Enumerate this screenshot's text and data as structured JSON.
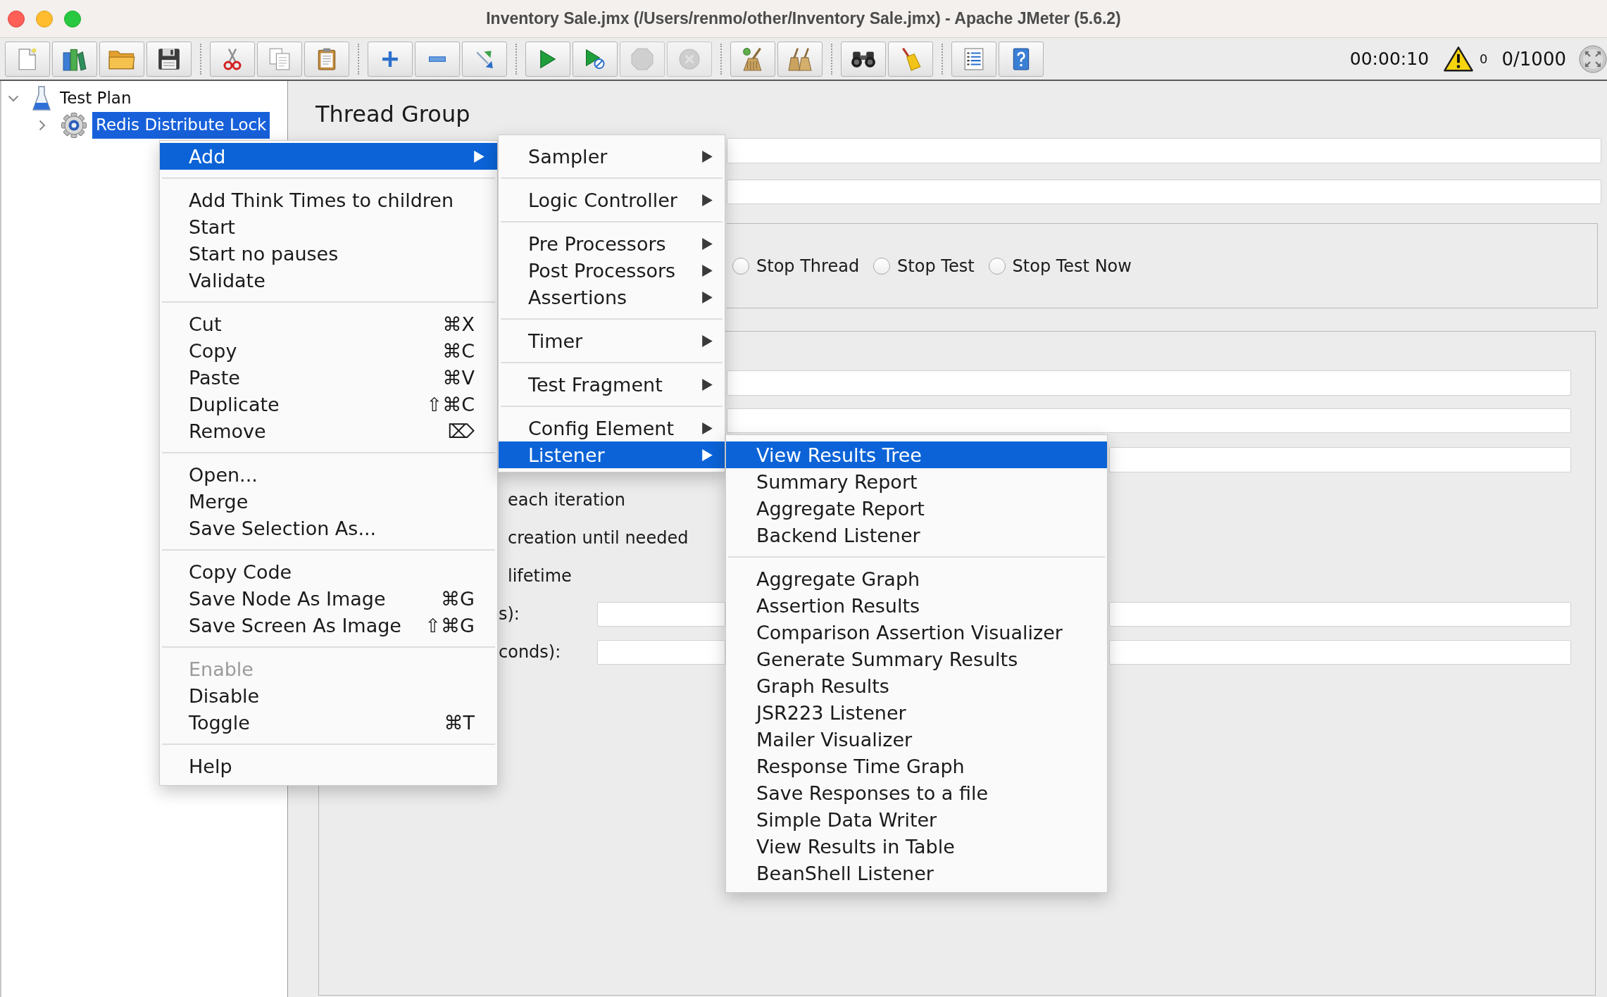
{
  "window": {
    "title": "Inventory Sale.jmx (/Users/renmo/other/Inventory Sale.jmx) - Apache JMeter (5.6.2)"
  },
  "toolbar": {
    "groups": [
      [
        {
          "kind": "new",
          "disabled": false
        },
        {
          "kind": "templates",
          "disabled": false
        },
        {
          "kind": "open",
          "disabled": false
        },
        {
          "kind": "save",
          "disabled": false
        }
      ],
      [
        {
          "kind": "cut",
          "disabled": false
        },
        {
          "kind": "copy",
          "disabled": false
        },
        {
          "kind": "paste",
          "disabled": false
        }
      ],
      [
        {
          "kind": "expand",
          "disabled": false
        },
        {
          "kind": "collapse",
          "disabled": false
        },
        {
          "kind": "toggle",
          "disabled": false
        }
      ],
      [
        {
          "kind": "start",
          "disabled": false
        },
        {
          "kind": "startnopause",
          "disabled": false
        },
        {
          "kind": "stop",
          "disabled": true
        },
        {
          "kind": "shutdown",
          "disabled": true
        }
      ],
      [
        {
          "kind": "clear",
          "disabled": false
        },
        {
          "kind": "clearall",
          "disabled": false
        }
      ],
      [
        {
          "kind": "search",
          "disabled": false
        },
        {
          "kind": "reset",
          "disabled": false
        }
      ],
      [
        {
          "kind": "functions",
          "disabled": false
        },
        {
          "kind": "help",
          "disabled": false
        }
      ]
    ]
  },
  "status": {
    "elapsed": "00:00:10",
    "errors": "0",
    "threads": "0/1000"
  },
  "tree": [
    {
      "label": "Test Plan",
      "kind": "plan",
      "expanded": true,
      "selected": false,
      "children": [
        {
          "label": "Redis Distribute Lock",
          "kind": "threadgroup",
          "expanded": false,
          "selected": true
        }
      ]
    }
  ],
  "panel": {
    "title": "Thread Group",
    "error_actions": [
      {
        "label": "Stop Thread",
        "selected": false
      },
      {
        "label": "Stop Test",
        "selected": false
      },
      {
        "label": "Stop Test Now",
        "selected": false
      }
    ],
    "rows": [
      {
        "kind": "text",
        "label": "each iteration"
      },
      {
        "kind": "text",
        "label": "creation until needed"
      },
      {
        "kind": "text",
        "label": "lifetime"
      },
      {
        "kind": "field",
        "label": "s):"
      },
      {
        "kind": "field",
        "label": "conds):"
      }
    ]
  },
  "context_menu": {
    "sections": [
      {
        "items": [
          {
            "label": "Add",
            "selected": true,
            "disabled": false,
            "submenu": true
          }
        ]
      },
      {
        "items": [
          {
            "label": "Add Think Times to children",
            "selected": false,
            "disabled": false,
            "submenu": false
          },
          {
            "label": "Start",
            "selected": false,
            "disabled": false,
            "submenu": false
          },
          {
            "label": "Start no pauses",
            "selected": false,
            "disabled": false,
            "submenu": false
          },
          {
            "label": "Validate",
            "selected": false,
            "disabled": false,
            "submenu": false
          }
        ]
      },
      {
        "items": [
          {
            "label": "Cut",
            "shortcut": "⌘X",
            "selected": false,
            "disabled": false,
            "submenu": false
          },
          {
            "label": "Copy",
            "shortcut": "⌘C",
            "selected": false,
            "disabled": false,
            "submenu": false
          },
          {
            "label": "Paste",
            "shortcut": "⌘V",
            "selected": false,
            "disabled": false,
            "submenu": false
          },
          {
            "label": "Duplicate",
            "shortcut": "⇧⌘C",
            "selected": false,
            "disabled": false,
            "submenu": false
          },
          {
            "label": "Remove",
            "shortcut": "⌦",
            "selected": false,
            "disabled": false,
            "submenu": false
          }
        ]
      },
      {
        "items": [
          {
            "label": "Open...",
            "selected": false,
            "disabled": false,
            "submenu": false
          },
          {
            "label": "Merge",
            "selected": false,
            "disabled": false,
            "submenu": false
          },
          {
            "label": "Save Selection As...",
            "selected": false,
            "disabled": false,
            "submenu": false
          }
        ]
      },
      {
        "items": [
          {
            "label": "Copy Code",
            "selected": false,
            "disabled": false,
            "submenu": false
          },
          {
            "label": "Save Node As Image",
            "shortcut": "⌘G",
            "selected": false,
            "disabled": false,
            "submenu": false
          },
          {
            "label": "Save Screen As Image",
            "shortcut": "⇧⌘G",
            "selected": false,
            "disabled": false,
            "submenu": false
          }
        ]
      },
      {
        "items": [
          {
            "label": "Enable",
            "selected": false,
            "disabled": true,
            "submenu": false
          },
          {
            "label": "Disable",
            "selected": false,
            "disabled": false,
            "submenu": false
          },
          {
            "label": "Toggle",
            "shortcut": "⌘T",
            "selected": false,
            "disabled": false,
            "submenu": false
          }
        ]
      },
      {
        "items": [
          {
            "label": "Help",
            "selected": false,
            "disabled": false,
            "submenu": false
          }
        ]
      }
    ]
  },
  "add_submenu": {
    "sections": [
      {
        "items": [
          {
            "label": "Sampler",
            "selected": false,
            "submenu": true
          }
        ]
      },
      {
        "items": [
          {
            "label": "Logic Controller",
            "selected": false,
            "submenu": true
          }
        ]
      },
      {
        "items": [
          {
            "label": "Pre Processors",
            "selected": false,
            "submenu": true
          },
          {
            "label": "Post Processors",
            "selected": false,
            "submenu": true
          },
          {
            "label": "Assertions",
            "selected": false,
            "submenu": true
          }
        ]
      },
      {
        "items": [
          {
            "label": "Timer",
            "selected": false,
            "submenu": true
          }
        ]
      },
      {
        "items": [
          {
            "label": "Test Fragment",
            "selected": false,
            "submenu": true
          }
        ]
      },
      {
        "items": [
          {
            "label": "Config Element",
            "selected": false,
            "submenu": true
          },
          {
            "label": "Listener",
            "selected": true,
            "submenu": true
          }
        ]
      }
    ]
  },
  "listener_submenu": {
    "sections": [
      {
        "items": [
          {
            "label": "View Results Tree",
            "selected": true
          },
          {
            "label": "Summary Report",
            "selected": false
          },
          {
            "label": "Aggregate Report",
            "selected": false
          },
          {
            "label": "Backend Listener",
            "selected": false
          }
        ]
      },
      {
        "items": [
          {
            "label": "Aggregate Graph",
            "selected": false
          },
          {
            "label": "Assertion Results",
            "selected": false
          },
          {
            "label": "Comparison Assertion Visualizer",
            "selected": false
          },
          {
            "label": "Generate Summary Results",
            "selected": false
          },
          {
            "label": "Graph Results",
            "selected": false
          },
          {
            "label": "JSR223 Listener",
            "selected": false
          },
          {
            "label": "Mailer Visualizer",
            "selected": false
          },
          {
            "label": "Response Time Graph",
            "selected": false
          },
          {
            "label": "Save Responses to a file",
            "selected": false
          },
          {
            "label": "Simple Data Writer",
            "selected": false
          },
          {
            "label": "View Results in Table",
            "selected": false
          },
          {
            "label": "BeanShell Listener",
            "selected": false
          }
        ]
      }
    ]
  }
}
